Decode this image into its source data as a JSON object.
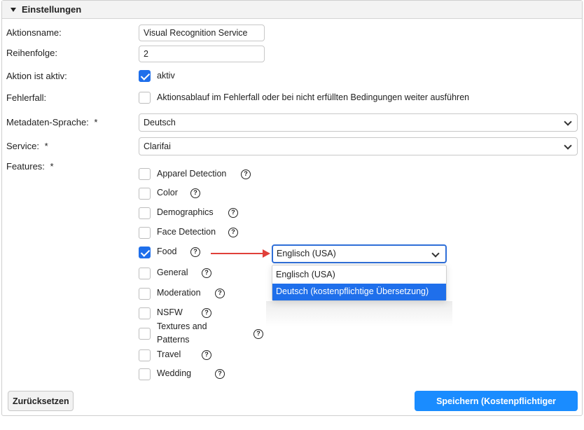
{
  "panel": {
    "title": "Einstellungen"
  },
  "form": {
    "action_name": {
      "label": "Aktionsname:",
      "value": "Visual Recognition Service"
    },
    "order": {
      "label": "Reihenfolge:",
      "value": "2"
    },
    "active": {
      "label": "Aktion ist aktiv:",
      "checkbox_label": "aktiv",
      "checked": true
    },
    "error_case": {
      "label": "Fehlerfall:",
      "checkbox_label": "Aktionsablauf im Fehlerfall oder bei nicht erfüllten Bedingungen weiter ausführen",
      "checked": false
    },
    "metadata_language": {
      "label": "Metadaten-Sprache:",
      "required": "*",
      "value": "Deutsch"
    },
    "service": {
      "label": "Service:",
      "required": "*",
      "value": "Clarifai"
    },
    "features": {
      "label": "Features:",
      "required": "*",
      "help_glyph": "?",
      "items": [
        {
          "label": "Apparel Detection",
          "checked": false
        },
        {
          "label": "Color",
          "checked": false
        },
        {
          "label": "Demographics",
          "checked": false
        },
        {
          "label": "Face Detection",
          "checked": false
        },
        {
          "label": "Food",
          "checked": true
        },
        {
          "label": "General",
          "checked": false
        },
        {
          "label": "Moderation",
          "checked": false
        },
        {
          "label": "NSFW",
          "checked": false
        },
        {
          "label": "Textures and",
          "label_line2": "Patterns",
          "checked": false
        },
        {
          "label": "Travel",
          "checked": false
        },
        {
          "label": "Wedding",
          "checked": false
        }
      ]
    },
    "food_language": {
      "value": "Englisch (USA)",
      "options": [
        "Englisch (USA)",
        "Deutsch (kostenpflichtige Übersetzung)"
      ],
      "highlighted_index": 1
    }
  },
  "buttons": {
    "reset": "Zurücksetzen",
    "save": "Speichern (Kostenpflichtiger Service)"
  },
  "colors": {
    "accent": "#1f6feb",
    "primary_button": "#1a8cff",
    "arrow": "#e0403a"
  }
}
